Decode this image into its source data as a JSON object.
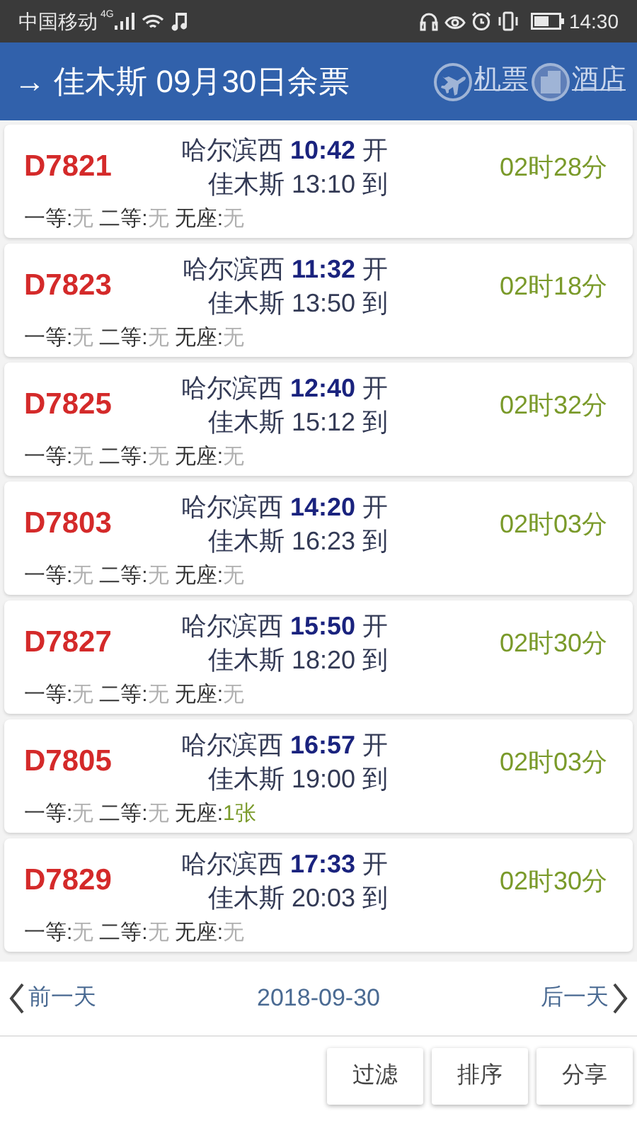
{
  "status_bar": {
    "carrier": "中国移动",
    "network": "4G",
    "time": "14:30"
  },
  "header": {
    "title": "→ 佳木斯 09月30日余票",
    "links": [
      {
        "kind": "flight",
        "label": "机票"
      },
      {
        "kind": "hotel",
        "label": "酒店"
      }
    ]
  },
  "trains": [
    {
      "number": "D7821",
      "from": "哈尔滨西",
      "depart": "10:42",
      "depart_suffix": "开",
      "to": "佳木斯",
      "arrive": "13:10",
      "arrive_suffix": "到",
      "duration": "02时28分",
      "seats": [
        {
          "label": "一等:",
          "value": "无",
          "available": false
        },
        {
          "label": "二等:",
          "value": "无",
          "available": false
        },
        {
          "label": "无座:",
          "value": "无",
          "available": false
        }
      ]
    },
    {
      "number": "D7823",
      "from": "哈尔滨西",
      "depart": "11:32",
      "depart_suffix": "开",
      "to": "佳木斯",
      "arrive": "13:50",
      "arrive_suffix": "到",
      "duration": "02时18分",
      "seats": [
        {
          "label": "一等:",
          "value": "无",
          "available": false
        },
        {
          "label": "二等:",
          "value": "无",
          "available": false
        },
        {
          "label": "无座:",
          "value": "无",
          "available": false
        }
      ]
    },
    {
      "number": "D7825",
      "from": "哈尔滨西",
      "depart": "12:40",
      "depart_suffix": "开",
      "to": "佳木斯",
      "arrive": "15:12",
      "arrive_suffix": "到",
      "duration": "02时32分",
      "seats": [
        {
          "label": "一等:",
          "value": "无",
          "available": false
        },
        {
          "label": "二等:",
          "value": "无",
          "available": false
        },
        {
          "label": "无座:",
          "value": "无",
          "available": false
        }
      ]
    },
    {
      "number": "D7803",
      "from": "哈尔滨西",
      "depart": "14:20",
      "depart_suffix": "开",
      "to": "佳木斯",
      "arrive": "16:23",
      "arrive_suffix": "到",
      "duration": "02时03分",
      "seats": [
        {
          "label": "一等:",
          "value": "无",
          "available": false
        },
        {
          "label": "二等:",
          "value": "无",
          "available": false
        },
        {
          "label": "无座:",
          "value": "无",
          "available": false
        }
      ]
    },
    {
      "number": "D7827",
      "from": "哈尔滨西",
      "depart": "15:50",
      "depart_suffix": "开",
      "to": "佳木斯",
      "arrive": "18:20",
      "arrive_suffix": "到",
      "duration": "02时30分",
      "seats": [
        {
          "label": "一等:",
          "value": "无",
          "available": false
        },
        {
          "label": "二等:",
          "value": "无",
          "available": false
        },
        {
          "label": "无座:",
          "value": "无",
          "available": false
        }
      ]
    },
    {
      "number": "D7805",
      "from": "哈尔滨西",
      "depart": "16:57",
      "depart_suffix": "开",
      "to": "佳木斯",
      "arrive": "19:00",
      "arrive_suffix": "到",
      "duration": "02时03分",
      "seats": [
        {
          "label": "一等:",
          "value": "无",
          "available": false
        },
        {
          "label": "二等:",
          "value": "无",
          "available": false
        },
        {
          "label": "无座:",
          "value": "1张",
          "available": true
        }
      ]
    },
    {
      "number": "D7829",
      "from": "哈尔滨西",
      "depart": "17:33",
      "depart_suffix": "开",
      "to": "佳木斯",
      "arrive": "20:03",
      "arrive_suffix": "到",
      "duration": "02时30分",
      "seats": [
        {
          "label": "一等:",
          "value": "无",
          "available": false
        },
        {
          "label": "二等:",
          "value": "无",
          "available": false
        },
        {
          "label": "无座:",
          "value": "无",
          "available": false
        }
      ]
    }
  ],
  "date_nav": {
    "prev": "前一天",
    "date": "2018-09-30",
    "next": "后一天"
  },
  "buttons": [
    "过滤",
    "排序",
    "分享"
  ]
}
